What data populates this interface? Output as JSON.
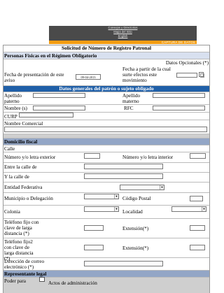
{
  "header": {
    "links": [
      "Consejos y Directorios",
      "Mapa del Sitio",
      "English"
    ],
    "banner_label": "CAPTURA DE DATOS"
  },
  "form": {
    "title": "Solicitud de Número de Registro Patronal",
    "section_personas": "Personas Físicas en el Régimen Obligatorio",
    "datos_opcionales": "Datos Opcionales (*)",
    "fecha_presentacion_label": "Fecha de presentación de este aviso",
    "fecha_presentacion_value": "09-04-2013",
    "fecha_efectos_label": "Fecha a partir de la cual surte efectos este movimiento",
    "datos_generales_band": "Datos generales del patrón o sujeto obligado",
    "apellido_paterno": "Apellido paterno",
    "apellido_materno": "Apellido materno",
    "nombres": "Nombre (s)",
    "rfc": "RFC",
    "curp": "CURP",
    "nombre_comercial": "Nombre Comercial",
    "domicilio_band": "Domicilio fiscal",
    "calle": "Calle",
    "numero_exterior": "Número y/o letra exterior",
    "numero_interior": "Número y/o letra interior",
    "entre_calle": "Entre la calle de",
    "y_la_calle": "Y la calle de",
    "entidad": "Entidad Federativa",
    "municipio": "Municipio o Delegación",
    "codigo_postal": "Código Postal",
    "colonia": "Colonia",
    "localidad": "Localidad",
    "telefono1": "Teléfono fijo con clave de larga distancia (*)",
    "extension1": "Extensión(*)",
    "telefono2": "Teléfono fijo2 con clave de larga distancia (*)",
    "extension2": "Extensión(*)",
    "correo": "Dirección de correo electrónico (*)",
    "representante_band": "Representante legal",
    "poder_para": "Poder para",
    "actos_admin": "Actos de administración"
  },
  "colors": {
    "blue_band": "#1f5fa8",
    "orange_bar": "#f39c12",
    "header_bar": "#4a4a4a"
  }
}
